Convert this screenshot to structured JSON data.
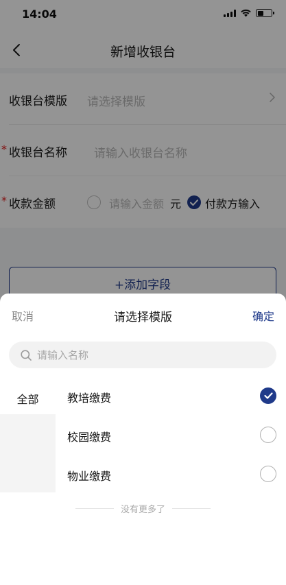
{
  "status_bar": {
    "time": "14:04"
  },
  "nav": {
    "title": "新增收银台"
  },
  "form": {
    "template": {
      "label": "收银台模版",
      "placeholder": "请选择模版"
    },
    "name": {
      "required_mark": "*",
      "label": "收银台名称",
      "placeholder": "请输入收银台名称"
    },
    "amount": {
      "required_mark": "*",
      "label": "收款金额",
      "option_input_placeholder": "请输入金额",
      "unit": "元",
      "option_payer": "付款方输入",
      "selected": "付款方输入"
    },
    "add_field_button": "+添加字段"
  },
  "sheet": {
    "cancel": "取消",
    "title": "请选择模版",
    "confirm": "确定",
    "search_placeholder": "请输入名称",
    "categories": [
      {
        "label": "全部",
        "selected": true
      }
    ],
    "options": [
      {
        "label": "教培缴费",
        "checked": true
      },
      {
        "label": "校园缴费",
        "checked": false
      },
      {
        "label": "物业缴费",
        "checked": false
      }
    ],
    "no_more_text": "没有更多了"
  },
  "colors": {
    "accent": "#1f3a8a",
    "required": "#e02020",
    "placeholder": "#b8b8b8"
  }
}
